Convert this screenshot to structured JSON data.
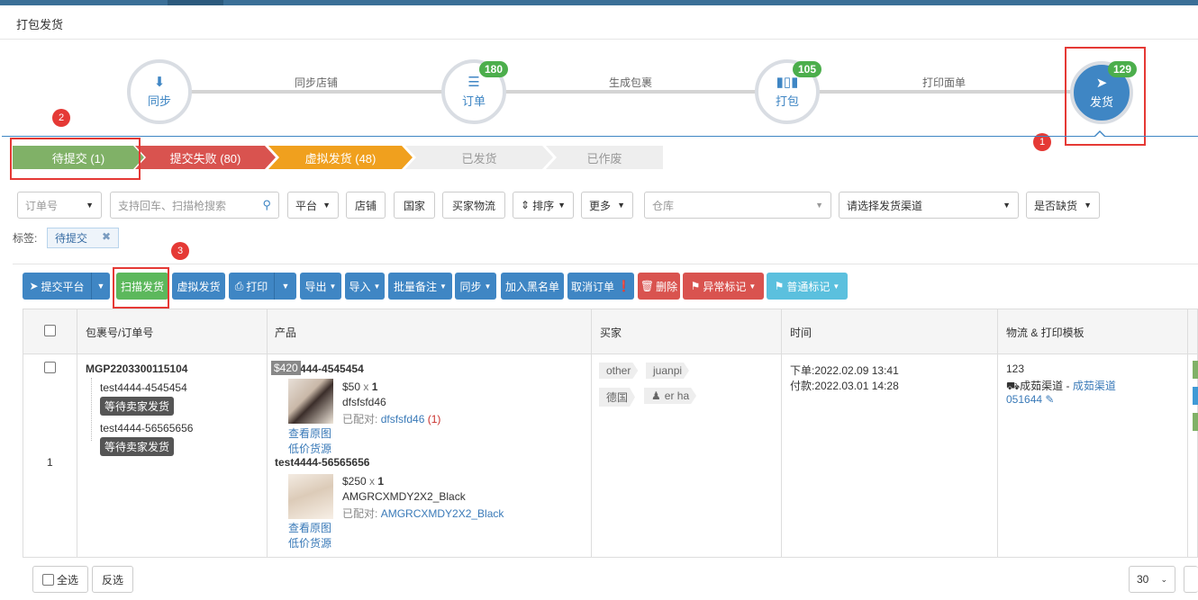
{
  "page_title": "打包发货",
  "steps": [
    {
      "label": "同步",
      "icon": "download-icon"
    },
    {
      "label": "订单",
      "icon": "list-icon",
      "badge": "180"
    },
    {
      "label": "打包",
      "icon": "barcode-icon",
      "badge": "105"
    },
    {
      "label": "发货",
      "icon": "send-icon",
      "badge": "129"
    }
  ],
  "step_links": [
    "同步店铺",
    "生成包裹",
    "打印面单"
  ],
  "annotations": [
    "1",
    "2",
    "3"
  ],
  "status_tabs": [
    {
      "label": "待提交 (1)",
      "color": "#80b167"
    },
    {
      "label": "提交失败 (80)",
      "color": "#d9534f"
    },
    {
      "label": "虚拟发货 (48)",
      "color": "#f0a01e"
    },
    {
      "label": "已发货",
      "color": "#eeeeee"
    },
    {
      "label": "已作废",
      "color": "#eeeeee"
    }
  ],
  "filters": {
    "order_no": "订单号",
    "search_placeholder": "支持回车、扫描枪搜索",
    "platform": "平台",
    "store": "店铺",
    "country": "国家",
    "buyer_logistics": "买家物流",
    "sort": "排序",
    "more": "更多",
    "warehouse_placeholder": "仓库",
    "channel": "请选择发货渠道",
    "shortage": "是否缺货"
  },
  "tags": {
    "label": "标签:",
    "active": "待提交"
  },
  "toolbar": {
    "submit_platform": "提交平台",
    "scan_ship": "扫描发货",
    "virtual_ship": "虚拟发货",
    "print": "打印",
    "export": "导出",
    "import": "导入",
    "batch_note": "批量备注",
    "sync": "同步",
    "blacklist": "加入黑名单",
    "cancel_order": "取消订单",
    "delete": "删除",
    "abnormal_mark": "异常标记",
    "normal_mark": "普通标记"
  },
  "table": {
    "headers": [
      "包裹号/订单号",
      "产品",
      "买家",
      "时间",
      "物流 & 打印模板"
    ],
    "row": {
      "index": "1",
      "package_no": "MGP2203300115104",
      "orders": [
        {
          "no": "test4444-4545454",
          "status": "等待卖家发货"
        },
        {
          "no": "test4444-56565656",
          "status": "等待卖家发货"
        }
      ],
      "price_overlay": "$420",
      "products": [
        {
          "order": "test4444-4545454",
          "price": "$50",
          "x": "x",
          "qty": "1",
          "sku": "dfsfsfd46",
          "matched_label": "已配对:",
          "matched": "dfsfsfd46",
          "matched_count": "(1)",
          "view": "查看原图",
          "cheap": "低价货源"
        },
        {
          "order": "test4444-56565656",
          "price": "$250",
          "x": "x",
          "qty": "1",
          "sku": "AMGRCXMDY2X2_Black",
          "matched_label": "已配对:",
          "matched": "AMGRCXMDY2X2_Black",
          "view": "查看原图",
          "cheap": "低价货源"
        }
      ],
      "buyer_tags": [
        "other",
        "juanpi",
        "德国",
        "er ha"
      ],
      "time_order": "下单:2022.02.09 13:41",
      "time_paid": "付款:2022.03.01 14:28",
      "logistics_no": "123",
      "logistics_channel": "成茹渠道",
      "logistics_dash": "-",
      "logistics_link": "成茹渠道",
      "template": "051644"
    }
  },
  "footer": {
    "select_all": "全选",
    "invert": "反选",
    "page_size": "30"
  }
}
